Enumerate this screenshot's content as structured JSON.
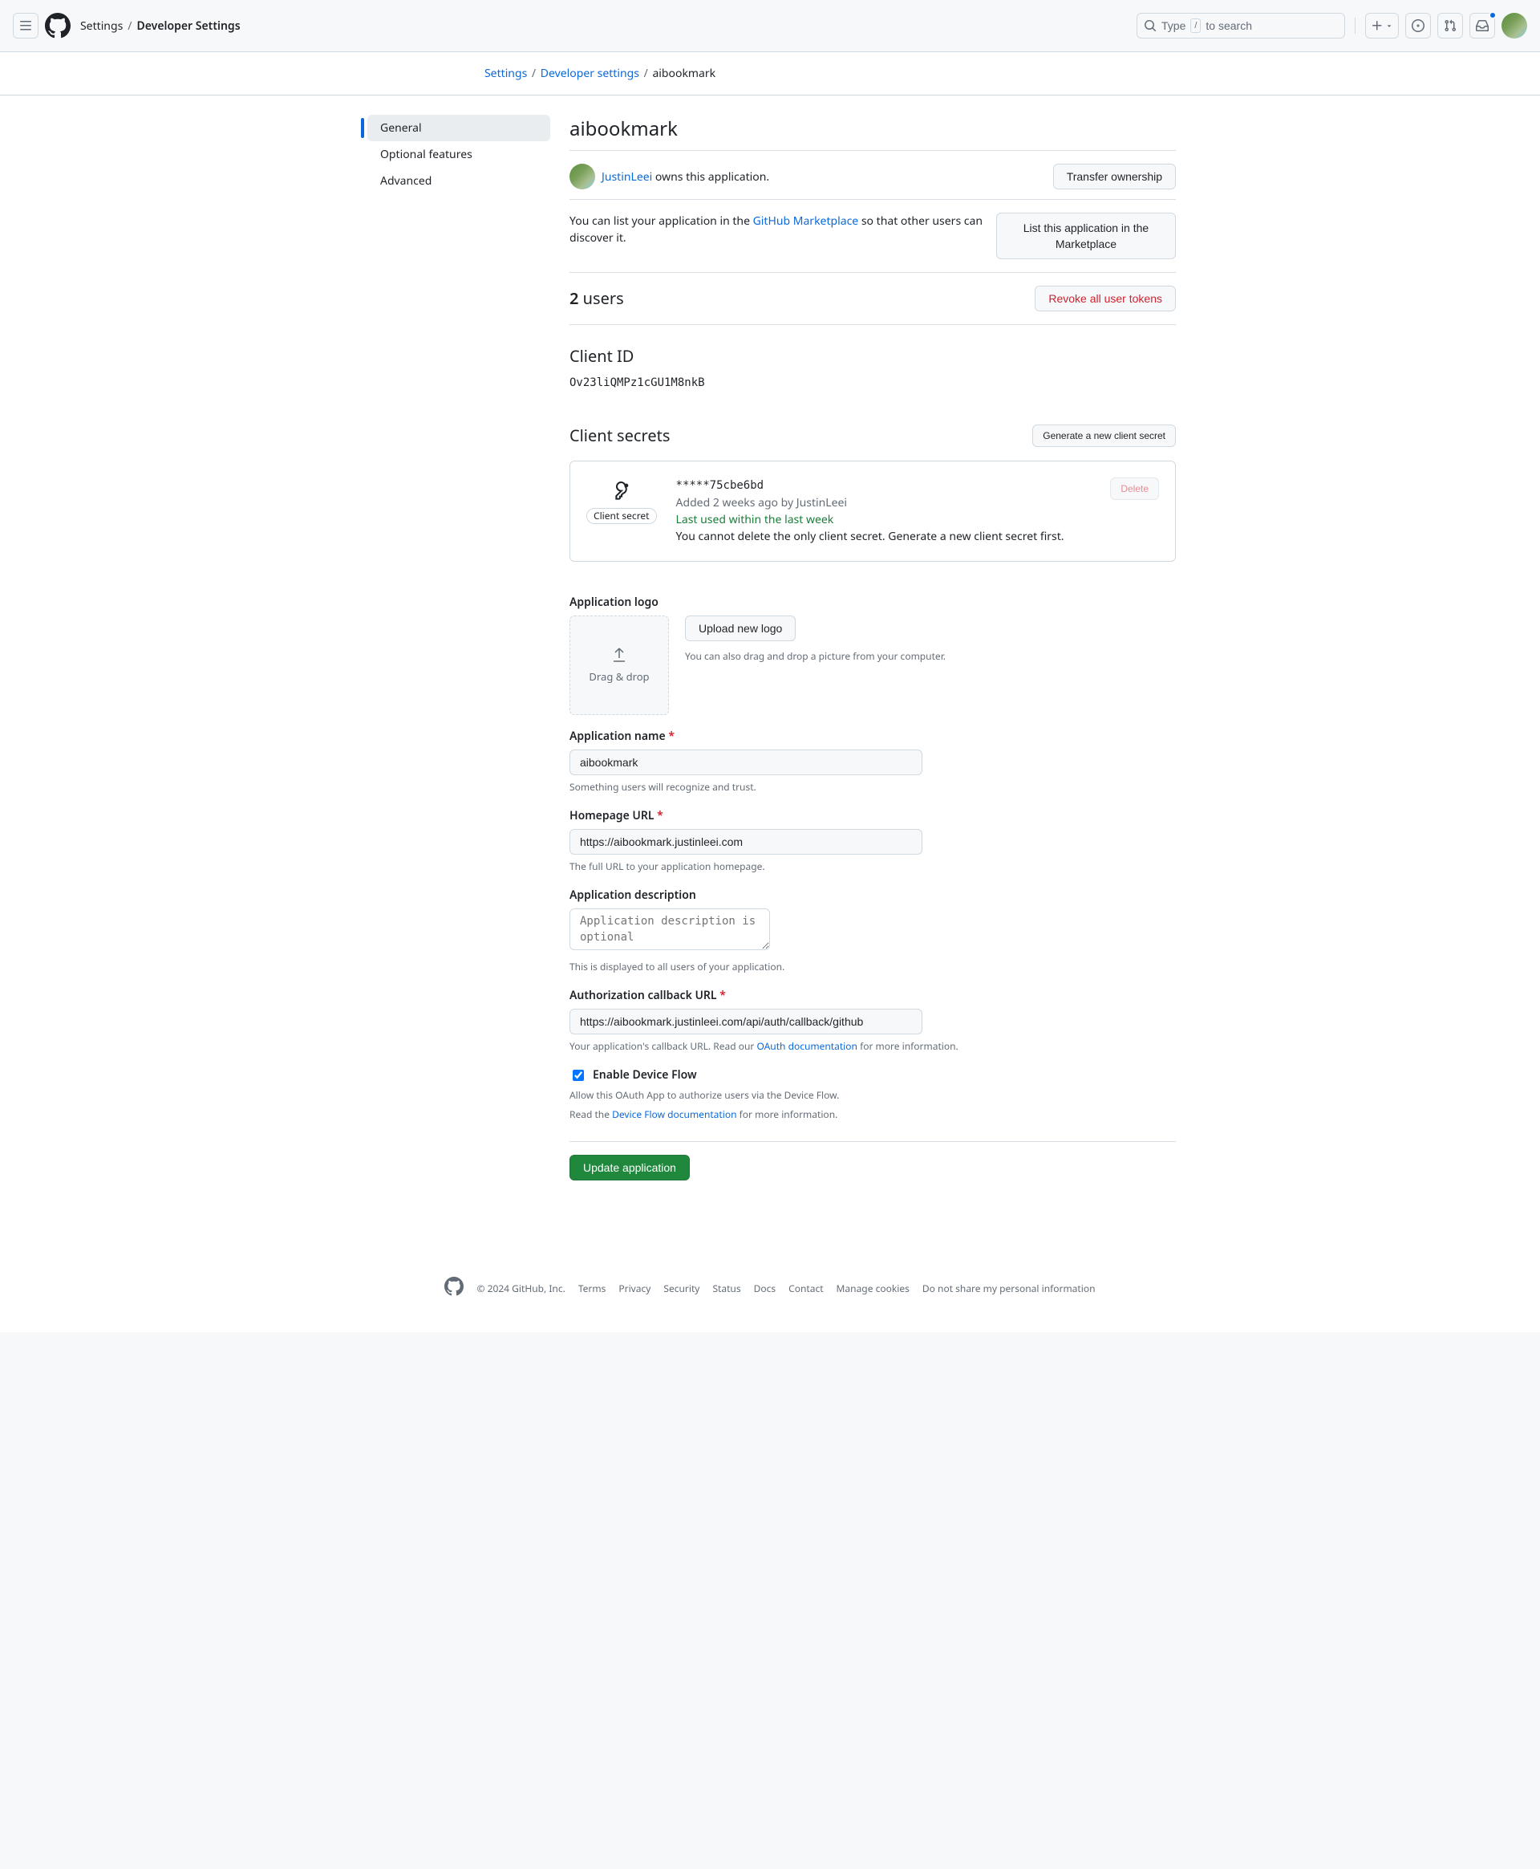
{
  "header": {
    "breadcrumb1": "Settings",
    "breadcrumb2": "Developer Settings",
    "search_prefix": "Type",
    "search_key": "/",
    "search_suffix": "to search"
  },
  "breadcrumb": {
    "item1": "Settings",
    "item2": "Developer settings",
    "item3": "aibookmark"
  },
  "sidebar": {
    "items": [
      {
        "label": "General"
      },
      {
        "label": "Optional features"
      },
      {
        "label": "Advanced"
      }
    ]
  },
  "page": {
    "title": "aibookmark",
    "owner_name": "JustinLeei",
    "owner_suffix": " owns this application.",
    "transfer_button": "Transfer ownership",
    "marketplace_text_pre": "You can list your application in the ",
    "marketplace_link": "GitHub Marketplace",
    "marketplace_text_post": " so that other users can discover it.",
    "marketplace_button": "List this application in the Marketplace",
    "users_count": "2",
    "users_label": " users",
    "revoke_button": "Revoke all user tokens",
    "client_id_label": "Client ID",
    "client_id_value": "Ov23liQMPz1cGU1M8nkB",
    "client_secrets_label": "Client secrets",
    "generate_secret_button": "Generate a new client secret"
  },
  "secret": {
    "badge": "Client secret",
    "hash": "*****75cbe6bd",
    "added_prefix": "Added 2 weeks ago by ",
    "added_by": "JustinLeei",
    "last_used": "Last used within the last week",
    "cannot_delete": "You cannot delete the only client secret. Generate a new client secret first.",
    "delete_button": "Delete"
  },
  "form": {
    "logo_heading": "Application logo",
    "drag_drop": "Drag & drop",
    "upload_button": "Upload new logo",
    "upload_note": "You can also drag and drop a picture from your computer.",
    "name_label": "Application name",
    "name_value": "aibookmark",
    "name_note": "Something users will recognize and trust.",
    "homepage_label": "Homepage URL",
    "homepage_value": "https://aibookmark.justinleei.com",
    "homepage_note": "The full URL to your application homepage.",
    "desc_label": "Application description",
    "desc_placeholder": "Application description is optional",
    "desc_note": "This is displayed to all users of your application.",
    "callback_label": "Authorization callback URL",
    "callback_value": "https://aibookmark.justinleei.com/api/auth/callback/github",
    "callback_note_pre": "Your application's callback URL. Read our ",
    "callback_note_link": "OAuth documentation",
    "callback_note_post": " for more information.",
    "device_flow_label": "Enable Device Flow",
    "device_flow_note1": "Allow this OAuth App to authorize users via the Device Flow.",
    "device_flow_note2_pre": "Read the ",
    "device_flow_note2_link": "Device Flow documentation",
    "device_flow_note2_post": " for more information.",
    "submit_button": "Update application"
  },
  "footer": {
    "copyright": "© 2024 GitHub, Inc.",
    "links": [
      "Terms",
      "Privacy",
      "Security",
      "Status",
      "Docs",
      "Contact",
      "Manage cookies",
      "Do not share my personal information"
    ]
  }
}
